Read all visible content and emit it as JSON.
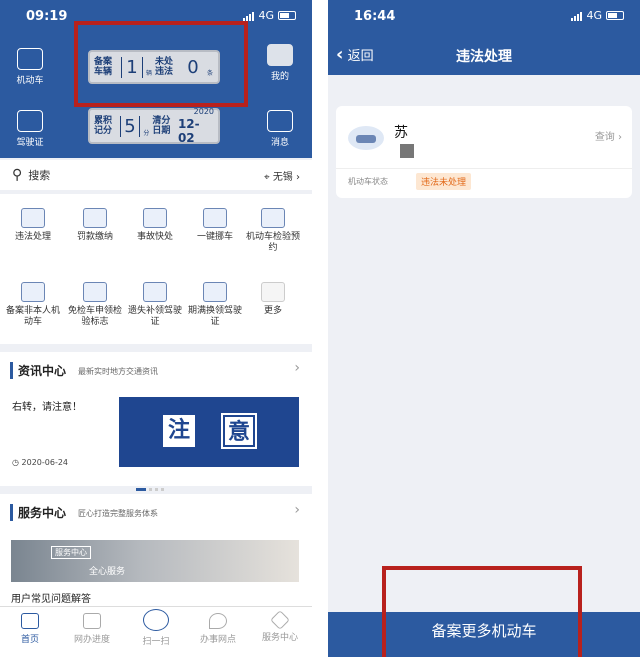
{
  "screen1": {
    "status": {
      "time": "09:19",
      "network": "4G"
    },
    "header": {
      "left_top": "机动车",
      "left_bottom": "驾驶证",
      "right_top": "我的",
      "right_bottom": "消息",
      "plate1": {
        "label": "备案车辆",
        "value": "1",
        "unit": "辆",
        "label2": "未处违法",
        "value2": "0",
        "unit2": "条"
      },
      "plate2": {
        "label": "累积记分",
        "value": "5",
        "unit": "分",
        "label2": "清分日期",
        "year": "2020",
        "date": "12-02"
      }
    },
    "search": {
      "placeholder": "搜索",
      "city": "无锡"
    },
    "services": [
      {
        "label": "违法处理",
        "icon": "car-violation-icon"
      },
      {
        "label": "罚款缴纳",
        "icon": "fine-payment-icon"
      },
      {
        "label": "事故快处",
        "icon": "accident-icon"
      },
      {
        "label": "一键挪车",
        "icon": "move-car-icon"
      },
      {
        "label": "机动车检验预约",
        "icon": "inspection-icon"
      },
      {
        "label": "备案非本人机动车",
        "icon": "record-vehicle-icon"
      },
      {
        "label": "免检车申领检验标志",
        "icon": "exempt-sticker-icon"
      },
      {
        "label": "遗失补领驾驶证",
        "icon": "lost-license-icon"
      },
      {
        "label": "期满换领驾驶证",
        "icon": "renew-license-icon"
      },
      {
        "label": "更多",
        "icon": "more-icon"
      }
    ],
    "news": {
      "title": "资讯中心",
      "subtitle": "最新实时地方交通资讯",
      "headline": "右转，请注意！",
      "date": "2020-06-24",
      "banner_left": "注",
      "banner_right": "意"
    },
    "service_center": {
      "title": "服务中心",
      "subtitle": "匠心打造完整服务体系",
      "tag": "服务中心",
      "banner_text": "全心服务",
      "faq": "用户常见问题解答"
    },
    "tabs": [
      "首页",
      "网办进度",
      "扫一扫",
      "办事网点",
      "服务中心"
    ]
  },
  "screen2": {
    "status": {
      "time": "16:44",
      "network": "4G"
    },
    "nav": {
      "back": "返回",
      "title": "违法处理"
    },
    "vehicle": {
      "plate_prefix": "苏",
      "query": "查询",
      "status_label": "机动车状态",
      "status_value": "违法未处理"
    },
    "bottom_button": "备案更多机动车"
  },
  "colors": {
    "brand": "#2c5aa0",
    "highlight": "#b8211d",
    "badge_bg": "#fde7d2",
    "badge_text": "#e26a1a"
  }
}
